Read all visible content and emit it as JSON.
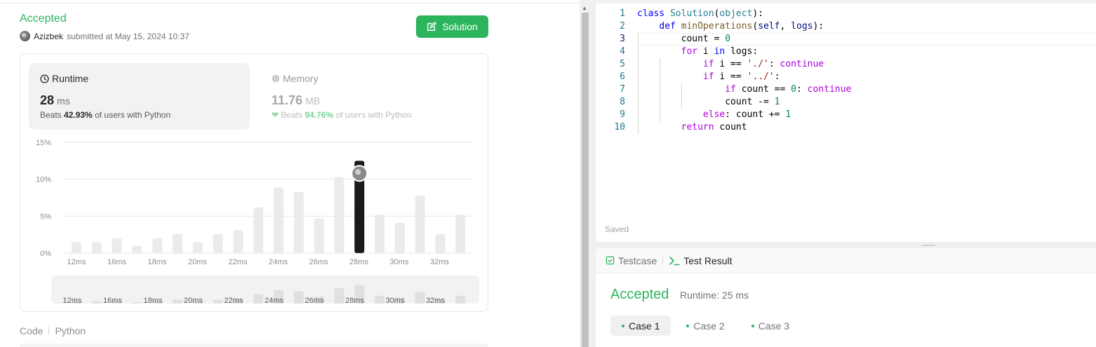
{
  "submission": {
    "status": "Accepted",
    "username": "Azizbek",
    "submitted_text": "submitted at May 15, 2024 10:37",
    "solution_button": "Solution"
  },
  "runtime": {
    "title": "Runtime",
    "value": "28",
    "unit": "ms",
    "beats_prefix": "Beats",
    "beats_value": "42.93%",
    "beats_suffix": "of users with Python"
  },
  "memory": {
    "title": "Memory",
    "value": "11.76",
    "unit": "MB",
    "beats_prefix": "Beats",
    "beats_value": "94.76%",
    "beats_suffix": "of users with Python"
  },
  "chart_data": {
    "type": "bar",
    "ylim": [
      0,
      15
    ],
    "yticks": [
      "15%",
      "10%",
      "5%",
      "0%"
    ],
    "ytick_values": [
      15,
      10,
      5,
      0
    ],
    "xtick_labels": [
      "12ms",
      "16ms",
      "18ms",
      "20ms",
      "22ms",
      "24ms",
      "26ms",
      "28ms",
      "30ms",
      "32ms"
    ],
    "values": [
      1.5,
      1.5,
      2.0,
      1.0,
      2.0,
      2.6,
      1.5,
      2.6,
      3.1,
      6.2,
      8.9,
      8.3,
      4.7,
      10.3,
      12.5,
      5.2,
      4.1,
      7.8,
      2.6,
      5.2
    ],
    "highlight_index": 14,
    "grid": true,
    "colors": {
      "bar": "#ebebeb",
      "highlight": "#1a1a1a",
      "grid": "#e6e6e6"
    },
    "mini": {
      "xtick_labels": [
        "12ms",
        "16ms",
        "18ms",
        "20ms",
        "22ms",
        "24ms",
        "26ms",
        "28ms",
        "30ms",
        "32ms"
      ]
    }
  },
  "code_tabs": {
    "code": "Code",
    "lang": "Python"
  },
  "editor": {
    "line_numbers": [
      "1",
      "2",
      "3",
      "4",
      "5",
      "6",
      "7",
      "8",
      "9",
      "10"
    ],
    "saved": "Saved"
  },
  "test_panel": {
    "tab_testcase": "Testcase",
    "tab_result": "Test Result",
    "status": "Accepted",
    "runtime": "Runtime: 25 ms",
    "cases": [
      "Case 1",
      "Case 2",
      "Case 3"
    ]
  },
  "colors": {
    "accent": "#2db55d"
  }
}
